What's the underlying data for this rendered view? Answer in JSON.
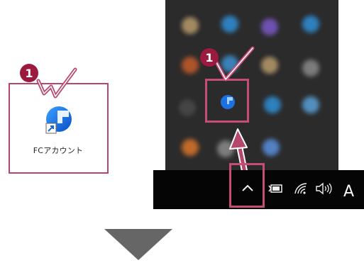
{
  "desktop": {
    "shortcut_label": "FCアカウント",
    "step_badge": "1"
  },
  "tray": {
    "step_badge": "1",
    "highlighted_icon": "fc-account-tray-icon",
    "blurred_icon_colors": [
      "#b89a6a",
      "#2f8fd8",
      "#7a58c8",
      "#2f8fd8",
      "#c65b2a",
      "#3d8fd0",
      "#b89a6a",
      "#8a8a8a",
      "#4a4a4a",
      "#1f6fd6",
      "#2f8fd8",
      "#5aa0d8",
      "#d9762a",
      "#8c8c8c",
      "#5a8fe0"
    ]
  },
  "taskbar": {
    "overflow_icon": "chevron-up-icon",
    "battery_icon": "battery-icon",
    "wifi_icon": "wifi-icon",
    "volume_icon": "volume-icon",
    "ime_indicator": "A"
  },
  "colors": {
    "accent": "#b5476a",
    "badge": "#9b1b3f",
    "tray_bg": "#2b2b2b",
    "taskbar_bg": "#050505",
    "arrow": "#666666"
  }
}
